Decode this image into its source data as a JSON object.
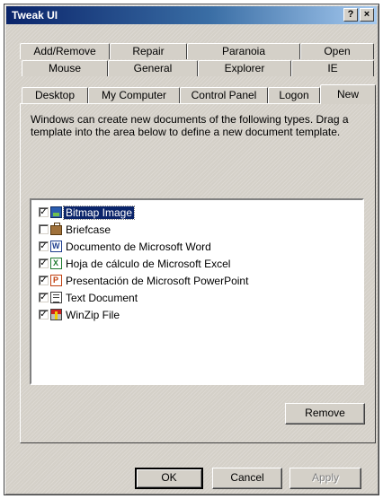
{
  "window": {
    "title": "Tweak UI",
    "help_glyph": "?",
    "close_glyph": "×"
  },
  "tabs": {
    "row1": [
      "Add/Remove",
      "Repair",
      "Paranoia",
      "Open"
    ],
    "row2": [
      "Mouse",
      "General",
      "Explorer",
      "IE"
    ],
    "row3": [
      "Desktop",
      "My Computer",
      "Control Panel",
      "Logon",
      "New"
    ],
    "active": "New"
  },
  "panel": {
    "instructions": "Windows can create new documents of the following types.  Drag a template into the area below to define a new document template."
  },
  "list": {
    "check_glyph": "✓",
    "items": [
      {
        "label": "Bitmap Image",
        "checked": true,
        "icon": "bitmap-icon",
        "selected": true
      },
      {
        "label": "Briefcase",
        "checked": false,
        "icon": "briefcase-icon",
        "selected": false
      },
      {
        "label": "Documento de Microsoft Word",
        "checked": true,
        "icon": "word-document-icon",
        "selected": false
      },
      {
        "label": "Hoja de cálculo de Microsoft Excel",
        "checked": true,
        "icon": "excel-sheet-icon",
        "selected": false
      },
      {
        "label": "Presentación de Microsoft PowerPoint",
        "checked": true,
        "icon": "powerpoint-icon",
        "selected": false
      },
      {
        "label": "Text Document",
        "checked": true,
        "icon": "text-document-icon",
        "selected": false
      },
      {
        "label": "WinZip File",
        "checked": true,
        "icon": "winzip-icon",
        "selected": false
      }
    ]
  },
  "buttons": {
    "remove": "Remove",
    "ok": "OK",
    "cancel": "Cancel",
    "apply": "Apply"
  },
  "colors": {
    "face": "#d4d0c8",
    "title_start": "#0a246a",
    "title_end": "#a6caf0",
    "selection": "#0a246a",
    "disabled_text": "#808080"
  }
}
